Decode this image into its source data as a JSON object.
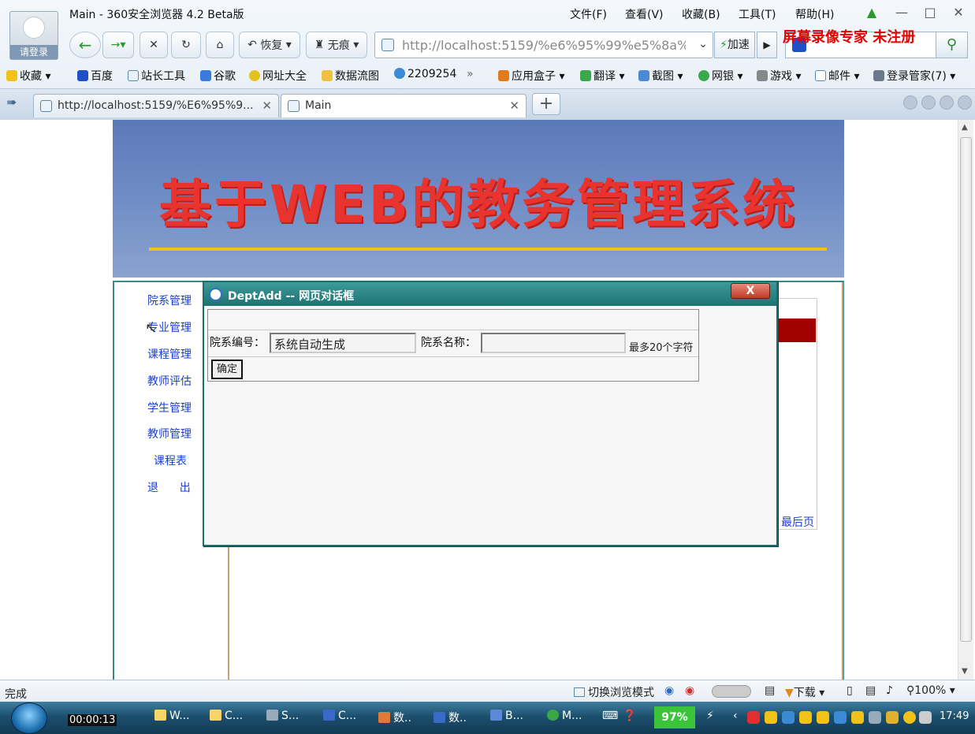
{
  "window": {
    "title": "Main - 360安全浏览器 4.2 Beta版",
    "user_label": "请登录",
    "menu": [
      "文件(F)",
      "查看(V)",
      "收藏(B)",
      "工具(T)",
      "帮助(H)"
    ]
  },
  "toolbar": {
    "restore_label": "恢复",
    "incognito_label": "无痕",
    "url": "http://localhost:5159/%e6%95%99%e5%8a%",
    "accelerate_label": "加速",
    "watermark": "屏幕录像专家  未注册"
  },
  "bookmarks": [
    "收藏",
    "百度",
    "站长工具",
    "谷歌",
    "网址大全",
    "数据流图",
    "2209254",
    "»",
    "应用盒子",
    "翻译",
    "截图",
    "网银",
    "游戏",
    "邮件",
    "登录管家(7)"
  ],
  "tabs": [
    {
      "label": "http://localhost:5159/%E6%95%9..."
    },
    {
      "label": "Main"
    }
  ],
  "page": {
    "banner_title": "基于WEB的教务管理系统",
    "nav": [
      "院系管理",
      "专业管理",
      "课程管理",
      "教师评估",
      "学生管理",
      "教师管理",
      "课程表",
      "退      出"
    ],
    "last_page_link": "最后页"
  },
  "dialog": {
    "title": "DeptAdd -- 网页对话框",
    "close_label": "X",
    "dept_id_label": "院系编号：",
    "dept_id_value": "系统自动生成",
    "dept_name_label": "院系名称：",
    "dept_name_value": "",
    "hint": "最多20个字符",
    "ok_label": "确定"
  },
  "statusbar": {
    "status": "完成",
    "mode_switch": "切换浏览模式",
    "download": "下载",
    "zoom": "100%"
  },
  "taskbar": {
    "timer": "00:00:13",
    "tasks": [
      "W...",
      "C...",
      "S...",
      "C...",
      "数..",
      "数..",
      "B...",
      "M..."
    ],
    "cpu": "97%",
    "clock": "17:49"
  },
  "colors": {
    "accent": "#1e7272",
    "banner_text": "#e8332f",
    "link": "#1a3fd0",
    "watermark": "#e60000"
  }
}
